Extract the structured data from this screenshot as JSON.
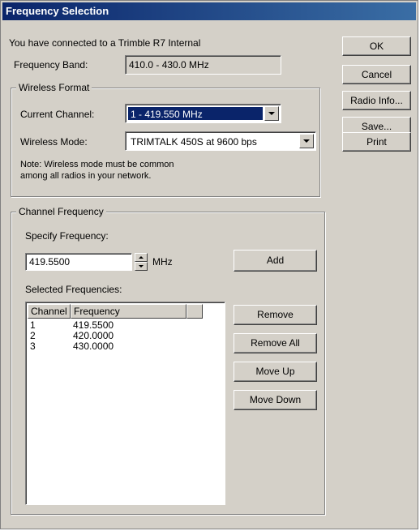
{
  "window": {
    "title": "Frequency Selection"
  },
  "header": {
    "connected_text": "You have connected to a Trimble R7 Internal",
    "freq_band_label": "Frequency Band:",
    "freq_band_value": "410.0 - 430.0 MHz"
  },
  "wireless_format": {
    "legend": "Wireless Format",
    "current_channel_label": "Current Channel:",
    "current_channel_value": "1 - 419.550 MHz",
    "wireless_mode_label": "Wireless Mode:",
    "wireless_mode_value": "TRIMTALK 450S at 9600 bps",
    "note_line1": "Note: Wireless mode must be common",
    "note_line2": "among all radios in your network."
  },
  "side_buttons": {
    "ok": "OK",
    "cancel": "Cancel",
    "radio_info": "Radio Info...",
    "save": "Save...",
    "print": "Print"
  },
  "channel_frequency": {
    "legend": "Channel Frequency",
    "specify_label": "Specify Frequency:",
    "specify_value": "419.5500",
    "unit": "MHz",
    "add": "Add",
    "selected_label": "Selected Frequencies:",
    "columns": [
      "Channel",
      "Frequency"
    ],
    "rows": [
      {
        "channel": "1",
        "frequency": "419.5500"
      },
      {
        "channel": "2",
        "frequency": "420.0000"
      },
      {
        "channel": "3",
        "frequency": "430.0000"
      }
    ],
    "remove": "Remove",
    "remove_all": "Remove All",
    "move_up": "Move Up",
    "move_down": "Move Down"
  }
}
